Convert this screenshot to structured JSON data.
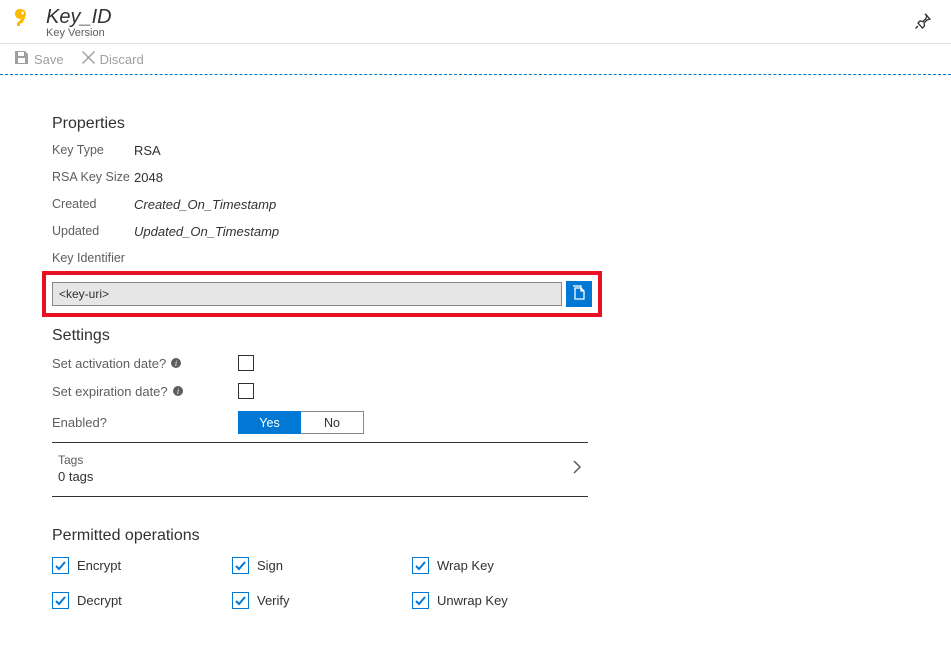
{
  "header": {
    "title": "Key_ID",
    "subtitle": "Key Version"
  },
  "toolbar": {
    "save": "Save",
    "discard": "Discard"
  },
  "properties": {
    "section": "Properties",
    "keyTypeLabel": "Key Type",
    "keyType": "RSA",
    "rsaSizeLabel": "RSA Key Size",
    "rsaSize": "2048",
    "createdLabel": "Created",
    "created": "Created_On_Timestamp",
    "updatedLabel": "Updated",
    "updated": "Updated_On_Timestamp",
    "keyIdLabel": "Key Identifier",
    "keyIdValue": "<key-uri>"
  },
  "settings": {
    "section": "Settings",
    "activationLabel": "Set activation date?",
    "expirationLabel": "Set expiration date?",
    "enabledLabel": "Enabled?",
    "yes": "Yes",
    "no": "No"
  },
  "tags": {
    "label": "Tags",
    "count": "0 tags"
  },
  "permitted": {
    "section": "Permitted operations",
    "ops": [
      "Encrypt",
      "Sign",
      "Wrap Key",
      "Decrypt",
      "Verify",
      "Unwrap Key"
    ]
  }
}
